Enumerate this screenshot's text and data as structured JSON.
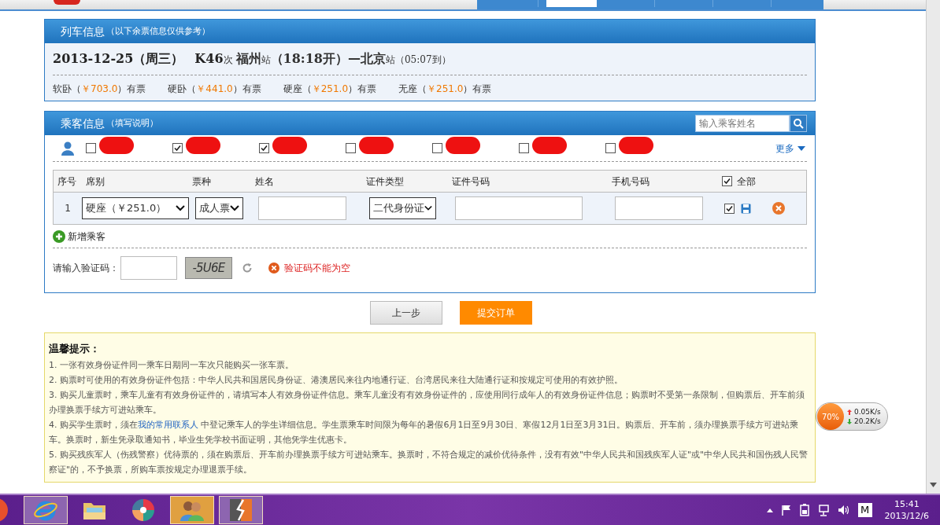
{
  "header": {
    "nav_tabs": [
      {
        "selected": false
      },
      {
        "selected": true
      },
      {
        "selected": false
      },
      {
        "selected": false
      },
      {
        "selected": false
      }
    ]
  },
  "train_panel": {
    "title": "列车信息",
    "note": "（以下余票信息仅供参考）",
    "date": "2013-12-25（周三）",
    "train_no": "K46",
    "train_suffix": "次",
    "from": "福州",
    "from_suffix": "站",
    "depart": "（18:18开）—",
    "to": "北京",
    "to_suffix": "站",
    "arrive": "（05:07到）",
    "seats": [
      {
        "label": "软卧（",
        "price": "￥703.0",
        "status": "）有票"
      },
      {
        "label": "硬卧（",
        "price": "￥441.0",
        "status": "）有票"
      },
      {
        "label": "硬座（",
        "price": "￥251.0",
        "status": "）有票"
      },
      {
        "label": "无座（",
        "price": "￥251.0",
        "status": "）有票"
      }
    ]
  },
  "passenger_panel": {
    "title": "乘客信息",
    "note": "（填写说明）",
    "search": {
      "placeholder": "输入乘客姓名"
    },
    "contacts": [
      {
        "checked": false
      },
      {
        "checked": true
      },
      {
        "checked": true
      },
      {
        "checked": false
      },
      {
        "checked": false
      },
      {
        "checked": false
      },
      {
        "checked": false
      }
    ],
    "more": "更多",
    "columns": [
      "序号",
      "席别",
      "票种",
      "姓名",
      "证件类型",
      "证件号码",
      "手机号码"
    ],
    "select_all": {
      "label": "全部",
      "checked": true
    },
    "rows": [
      {
        "index": "1",
        "seat": "硬座（￥251.0）",
        "ticket_type": "成人票",
        "id_type": "二代身份证",
        "checked": true
      }
    ],
    "add": "新增乘客",
    "captcha": {
      "label": "请输入验证码：",
      "image_text": "-5U6E",
      "error": "验证码不能为空"
    }
  },
  "buttons": {
    "prev": "上一步",
    "submit": "提交订单"
  },
  "tips": {
    "title": "温馨提示：",
    "items": [
      {
        "text": "1. 一张有效身份证件同一乘车日期同一车次只能购买一张车票。"
      },
      {
        "text": "2. 购票时可使用的有效身份证件包括：中华人民共和国居民身份证、港澳居民来往内地通行证、台湾居民来往大陆通行证和按规定可使用的有效护照。"
      },
      {
        "text": "3. 购买儿童票时，乘车儿童有有效身份证件的，请填写本人有效身份证件信息。乘车儿童没有有效身份证件的，应使用同行成年人的有效身份证件信息；购票时不受第一条限制，但购票后、开车前须办理换票手续方可进站乘车。"
      },
      {
        "text": "4. 购买学生票时，须在",
        "link": "我的常用联系人",
        "after": " 中登记乘车人的学生详细信息。学生票乘车时间限为每年的暑假6月1日至9月30日、寒假12月1日至3月31日。购票后、开车前，须办理换票手续方可进站乘车。换票时，新生凭录取通知书，毕业生凭学校书面证明，其他凭学生优惠卡。"
      },
      {
        "text": "5. 购买残疾军人（伤残警察）优待票的，须在购票后、开车前办理换票手续方可进站乘车。换票时，不符合规定的减价优待条件，没有有效\"中华人民共和国残疾军人证\"或\"中华人民共和国伤残人民警察证\"的，不予换票，所购车票按规定办理退票手续。"
      }
    ]
  },
  "net_widget": {
    "percent": "70%",
    "up": "0.05K/s",
    "down": "20.2K/s"
  },
  "taskbar": {
    "apps": [
      {
        "kind": "browser",
        "selected": false,
        "running": true
      },
      {
        "kind": "folder",
        "selected": false,
        "running": false
      },
      {
        "kind": "pinwheel",
        "selected": false,
        "running": false
      },
      {
        "kind": "people",
        "selected": true,
        "running": true
      },
      {
        "kind": "bolt",
        "selected": false,
        "running": true
      }
    ],
    "ime": "M",
    "time": "15:41",
    "date": "2013/12/6"
  }
}
